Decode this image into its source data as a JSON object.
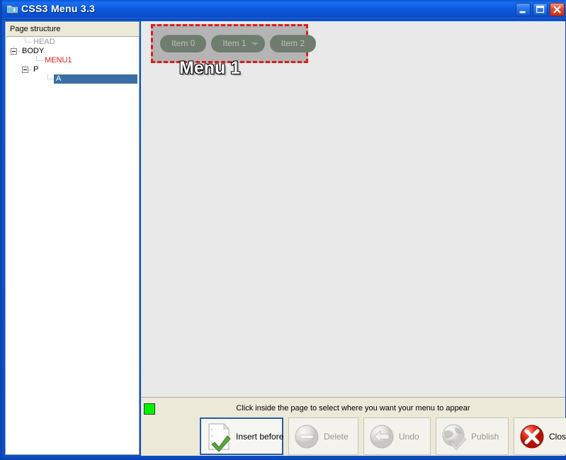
{
  "window": {
    "title": "CSS3 Menu 3.3",
    "icon": "folder-icon",
    "minimize_label": "Minimize",
    "maximize_label": "Maximize",
    "close_label": "Close"
  },
  "tree_panel": {
    "header": "Page structure",
    "nodes": [
      {
        "label": "HEAD",
        "depth": 1,
        "color": "#9a9a9a",
        "expander": "none",
        "selected": false
      },
      {
        "label": "BODY",
        "depth": 0,
        "color": "#000000",
        "expander": "collapse",
        "selected": false
      },
      {
        "label": "MENU1",
        "depth": 2,
        "color": "#d42020",
        "expander": "none",
        "selected": false
      },
      {
        "label": "P",
        "depth": 1,
        "color": "#000000",
        "expander": "collapse",
        "selected": false
      },
      {
        "label": "A",
        "depth": 3,
        "color": "#ffffff",
        "expander": "none",
        "selected": true
      }
    ]
  },
  "page_area": {
    "menu_title": "Menu 1",
    "selection_hint": "menu-selection-box",
    "menu_items": [
      {
        "label": "Item 0",
        "has_dropdown": false
      },
      {
        "label": "Item 1",
        "has_dropdown": true
      },
      {
        "label": "Item 2",
        "has_dropdown": false
      }
    ]
  },
  "status": {
    "message": "Click inside the page to select where you want your menu to appear",
    "led_color": "#00f200"
  },
  "toolbar": {
    "buttons": [
      {
        "label": "Insert before",
        "icon": "page-check-icon",
        "enabled": true,
        "focused": true
      },
      {
        "label": "Delete",
        "icon": "minus-circle-icon",
        "enabled": false,
        "focused": false
      },
      {
        "label": "Undo",
        "icon": "arrow-left-icon",
        "enabled": false,
        "focused": false
      },
      {
        "label": "Publish",
        "icon": "globe-check-icon",
        "enabled": false,
        "focused": false
      },
      {
        "label": "Close",
        "icon": "red-x-icon",
        "enabled": true,
        "focused": false
      }
    ]
  },
  "colors": {
    "titlebar_blue": "#0a5bd3",
    "selection_red": "#e01b1b",
    "tree_select_blue": "#3a6ea5",
    "menu_item_bg": "#6e7d6e",
    "panel_beige": "#ece9d8"
  }
}
